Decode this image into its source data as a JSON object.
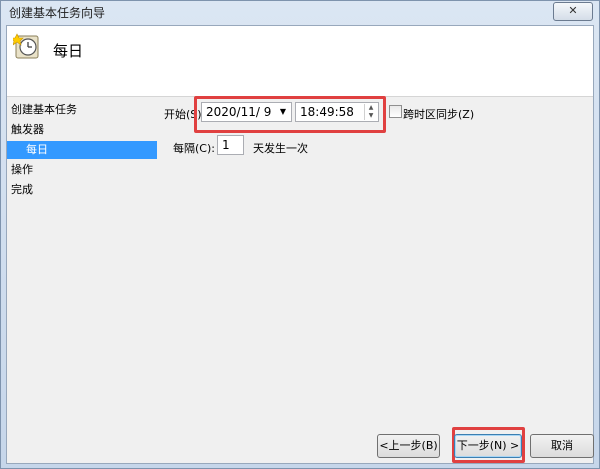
{
  "window": {
    "title": "创建基本任务向导",
    "close_label": "✕"
  },
  "header": {
    "title": "每日",
    "icon": "task-clock-icon"
  },
  "steps": [
    "创建基本任务",
    "触发器",
    "每日",
    "操作",
    "完成"
  ],
  "form": {
    "start_label": "开始(S):",
    "date_value": "2020/11/  9",
    "time_value": "18:49:58",
    "sync_label": "跨时区同步(Z)",
    "recur_label": "每隔(C):",
    "recur_value": "1",
    "recur_suffix": "天发生一次"
  },
  "buttons": {
    "back": "<上一步(B)",
    "next": "下一步(N) >",
    "cancel": "取消"
  },
  "colors": {
    "highlight": "#e04040",
    "selected_step": "#3399ff"
  }
}
